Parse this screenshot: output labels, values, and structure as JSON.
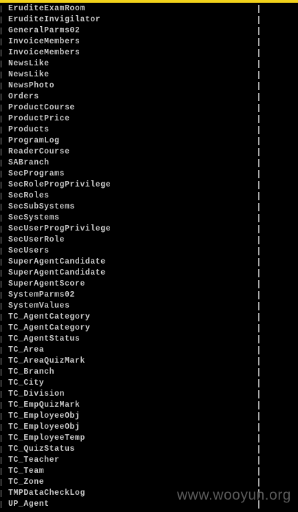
{
  "console": {
    "accent_bar_color": "#f2d21b",
    "text_color": "#c8c8c8",
    "background_color": "#000000",
    "rows": [
      "EruditeExamRoom",
      "EruditeInvigilator",
      "GeneralParms02",
      "InvoiceMembers",
      "InvoiceMembers",
      "NewsLike",
      "NewsLike",
      "NewsPhoto",
      "Orders",
      "ProductCourse",
      "ProductPrice",
      "Products",
      "ProgramLog",
      "ReaderCourse",
      "SABranch",
      "SecPrograms",
      "SecRoleProgPrivilege",
      "SecRoles",
      "SecSubSystems",
      "SecSystems",
      "SecUserProgPrivilege",
      "SecUserRole",
      "SecUsers",
      "SuperAgentCandidate",
      "SuperAgentCandidate",
      "SuperAgentScore",
      "SystemParms02",
      "SystemValues",
      "TC_AgentCategory",
      "TC_AgentCategory",
      "TC_AgentStatus",
      "TC_Area",
      "TC_AreaQuizMark",
      "TC_Branch",
      "TC_City",
      "TC_Division",
      "TC_EmpQuizMark",
      "TC_EmployeeObj",
      "TC_EmployeeObj",
      "TC_EmployeeTemp",
      "TC_QuizStatus",
      "TC_Teacher",
      "TC_Team",
      "TC_Zone",
      "TMPDataCheckLog",
      "UP_Agent"
    ]
  },
  "watermark": {
    "text": "www.wooyun.org"
  }
}
